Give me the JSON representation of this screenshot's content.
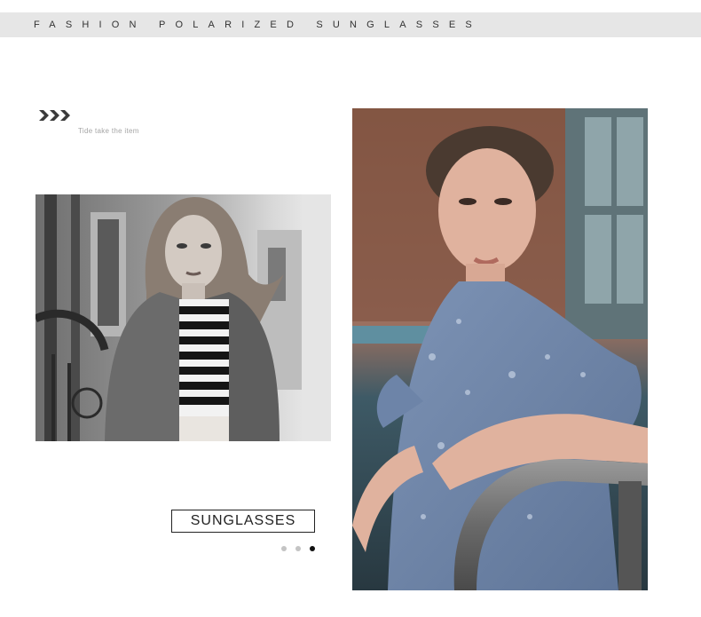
{
  "banner": {
    "text": "FASHION POLARIZED SUNGLASSES"
  },
  "intro": {
    "tagline": "Tide take the item",
    "arrow_icon": "triple-chevron-right-icon"
  },
  "photos": [
    {
      "name": "model-portrait-bw",
      "style": "black-and-white"
    },
    {
      "name": "model-portrait-color",
      "style": "color"
    }
  ],
  "cta": {
    "label": "SUNGLASSES"
  },
  "carousel": {
    "count": 3,
    "active_index": 2
  },
  "colors": {
    "banner_bg": "#e6e6e6",
    "text_dark": "#222222",
    "tagline": "#a5a5a5",
    "dot_inactive": "#c4c4c4",
    "dot_active": "#111111"
  }
}
